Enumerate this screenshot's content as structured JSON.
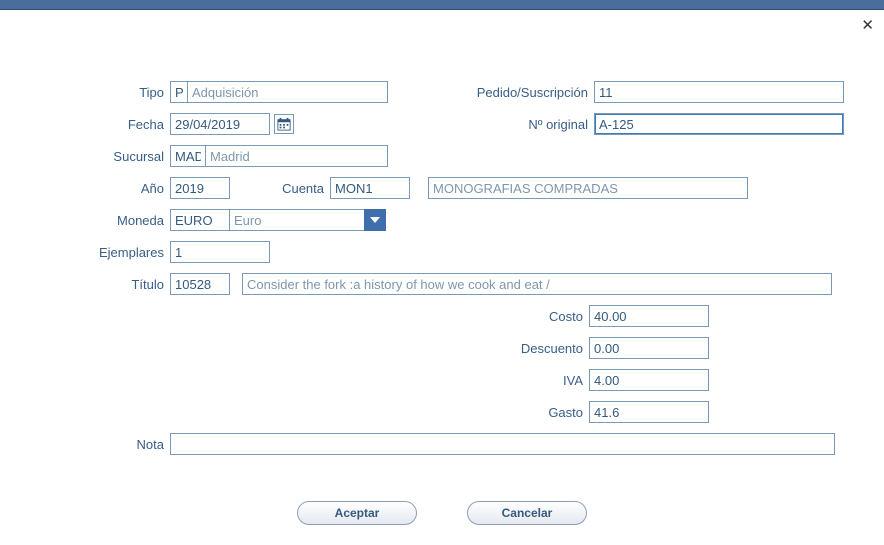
{
  "labels": {
    "tipo": "Tipo",
    "fecha": "Fecha",
    "sucursal": "Sucursal",
    "ano": "Año",
    "cuenta": "Cuenta",
    "moneda": "Moneda",
    "ejemplares": "Ejemplares",
    "titulo": "Título",
    "pedido": "Pedido/Suscripción",
    "noriginal": "Nº original",
    "costo": "Costo",
    "descuento": "Descuento",
    "iva": "IVA",
    "gasto": "Gasto",
    "nota": "Nota"
  },
  "values": {
    "tipo_code": "P",
    "tipo_desc": "Adquisición",
    "fecha": "29/04/2019",
    "sucursal_code": "MAD",
    "sucursal_desc": "Madrid",
    "ano": "2019",
    "cuenta_code": "MON1",
    "cuenta_desc": "MONOGRAFIAS COMPRADAS",
    "moneda_code": "EURO",
    "moneda_desc": "Euro",
    "ejemplares": "1",
    "titulo_id": "10528",
    "titulo_desc": "Consider the fork :a history of how we cook and eat /",
    "pedido": "11",
    "noriginal": "A-125",
    "costo": "40.00",
    "descuento": "0.00",
    "iva": "4.00",
    "gasto": "41.6",
    "nota": ""
  },
  "buttons": {
    "aceptar": "Aceptar",
    "cancelar": "Cancelar"
  }
}
